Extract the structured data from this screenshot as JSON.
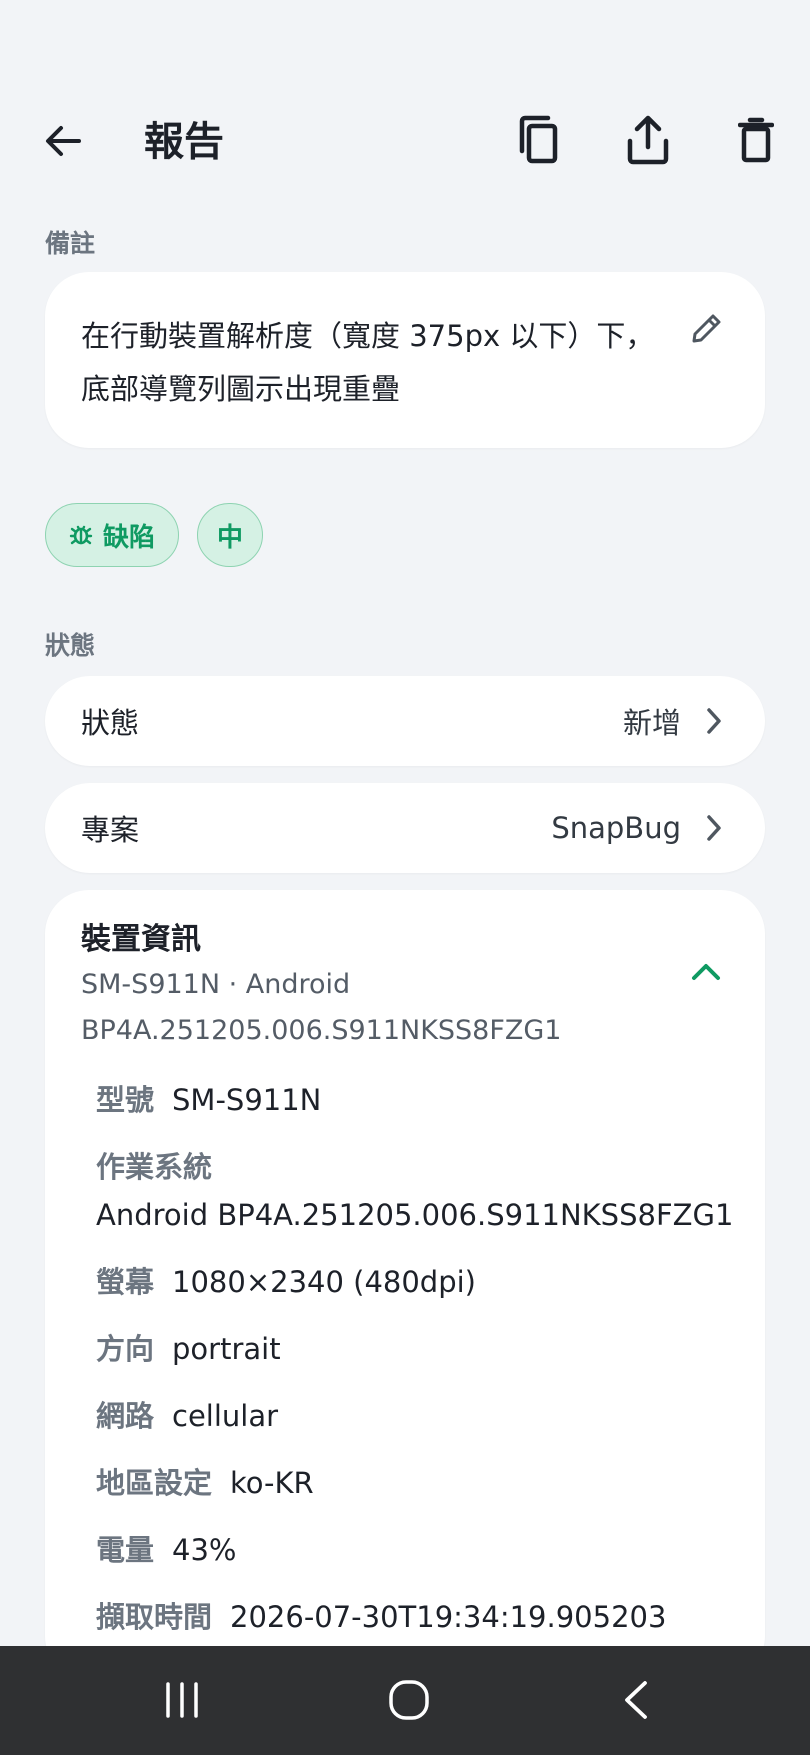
{
  "app_bar": {
    "title": "報告",
    "back_icon": "arrow-left-icon",
    "actions": [
      "copy-icon",
      "share-icon",
      "delete-icon"
    ]
  },
  "note": {
    "section_label": "備註",
    "text": "在行動裝置解析度（寬度 375px 以下）下，底部導覽列圖示出現重疊",
    "edit_icon": "pencil-icon"
  },
  "tags": {
    "type_label": "缺陷",
    "type_icon": "bug-icon",
    "severity_label": "中"
  },
  "status_section": {
    "section_label": "狀態",
    "status_row": {
      "label": "狀態",
      "value": "新增"
    },
    "project_row": {
      "label": "專案",
      "value": "SnapBug"
    }
  },
  "device": {
    "title": "裝置資訊",
    "summary_line1": "SM-S911N · Android",
    "summary_line2": "BP4A.251205.006.S911NKSS8FZG1",
    "details": [
      {
        "key": "型號",
        "value": "SM-S911N"
      },
      {
        "key": "作業系統",
        "value": "Android BP4A.251205.006.S911NKSS8FZG1"
      },
      {
        "key": "螢幕",
        "value": "1080×2340 (480dpi)"
      },
      {
        "key": "方向",
        "value": "portrait"
      },
      {
        "key": "網路",
        "value": "cellular"
      },
      {
        "key": "地區設定",
        "value": "ko-KR"
      },
      {
        "key": "電量",
        "value": "43%"
      },
      {
        "key": "擷取時間",
        "value": "2026-07-30T19:34:19.905203"
      }
    ]
  },
  "colors": {
    "accent": "#0f9a62",
    "chip_bg": "#d5f1e4",
    "background": "#f2f4f7",
    "navbar": "#2f3032"
  }
}
